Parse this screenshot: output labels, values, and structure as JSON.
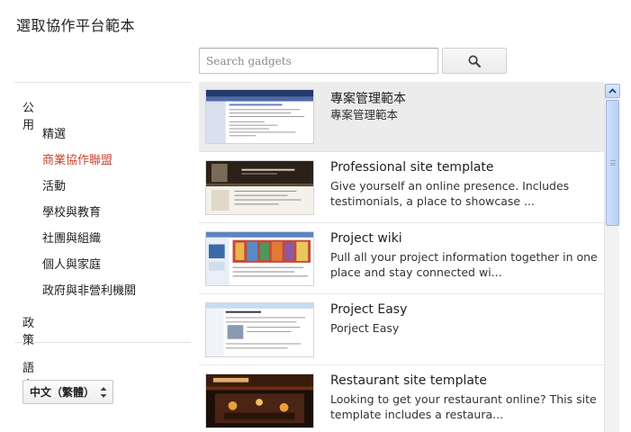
{
  "title": "選取協作平台範本",
  "search": {
    "placeholder": "Search gadgets"
  },
  "sidebar": {
    "public_heading": "公用",
    "items": [
      {
        "label": "精選"
      },
      {
        "label": "商業協作聯盟",
        "active": true
      },
      {
        "label": "活動"
      },
      {
        "label": "學校與教育"
      },
      {
        "label": "社團與組織"
      },
      {
        "label": "個人與家庭"
      },
      {
        "label": "政府與非營利機關"
      }
    ],
    "policy_heading": "政策",
    "language_heading": "語言",
    "language_value": "中文（繁體）"
  },
  "templates": [
    {
      "title": "專案管理範本",
      "description": "專案管理範本",
      "selected": true
    },
    {
      "title": "Professional site template",
      "description": "Give yourself an online presence. Includes testimonials, a place to showcase ..."
    },
    {
      "title": "Project wiki",
      "description": "Pull all your project information together in one place and stay connected wi..."
    },
    {
      "title": "Project Easy",
      "description": "Porject Easy"
    },
    {
      "title": "Restaurant site template",
      "description": "Looking to get your restaurant online? This site template includes a restaura..."
    }
  ],
  "colors": {
    "active_link": "#c4452e",
    "selected_row": "#ececec",
    "scrollbar_blue": "#c4d7f5"
  }
}
